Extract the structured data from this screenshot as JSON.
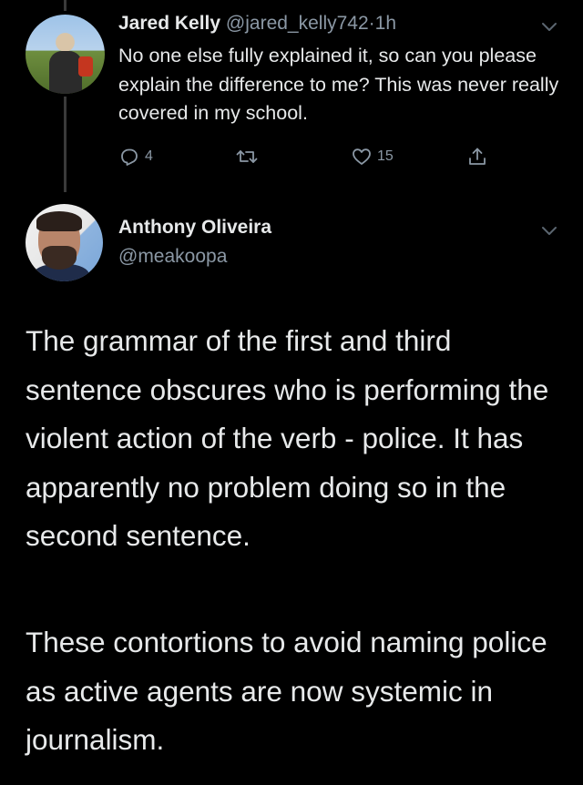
{
  "reply_tweet": {
    "display_name": "Jared Kelly",
    "handle": "@jared_kelly742",
    "separator": "·",
    "time": "1h",
    "text": "No one else fully explained it, so can you please explain the difference to me? This was never really covered in my school.",
    "actions": {
      "reply_count": "4",
      "retweet_count": "",
      "like_count": "15"
    }
  },
  "main_tweet": {
    "display_name": "Anthony Oliveira",
    "handle": "@meakoopa",
    "paragraphs": [
      "The grammar of the first and third sentence obscures who is performing the violent action of the verb - police. It has apparently no problem doing so in the second sentence.",
      "These contortions to avoid naming police as active agents are now systemic in journalism."
    ]
  },
  "icons": {
    "reply": "reply-icon",
    "retweet": "retweet-icon",
    "like": "heart-icon",
    "share": "share-icon",
    "more": "chevron-down-icon"
  },
  "colors": {
    "background": "#000000",
    "primary_text": "#e7e9ea",
    "secondary_text": "#8b98a5",
    "thread_line": "#3a3a3a"
  }
}
